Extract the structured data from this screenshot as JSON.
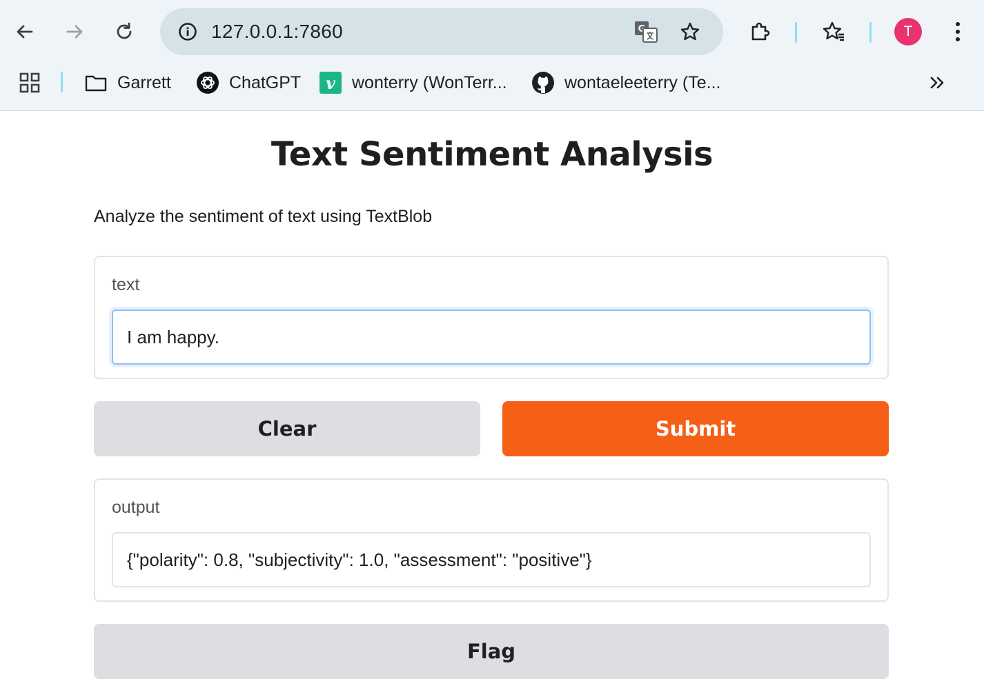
{
  "browser": {
    "url": "127.0.0.1:7860",
    "profile_initial": "T",
    "bookmarks": [
      {
        "label": "Garrett",
        "icon": "folder-icon"
      },
      {
        "label": "ChatGPT",
        "icon": "chatgpt-icon"
      },
      {
        "label": "wonterry (WonTerr...",
        "icon": "vimeo-icon"
      },
      {
        "label": "wontaeleeterry (Te...",
        "icon": "github-icon"
      }
    ]
  },
  "app": {
    "title": "Text Sentiment Analysis",
    "description": "Analyze the sentiment of text using TextBlob",
    "input": {
      "label": "text",
      "value": "I am happy."
    },
    "buttons": {
      "clear": "Clear",
      "submit": "Submit",
      "flag": "Flag"
    },
    "output": {
      "label": "output",
      "value": "{\"polarity\": 0.8, \"subjectivity\": 1.0, \"assessment\": \"positive\"}"
    }
  },
  "colors": {
    "primary_button": "#f55f16",
    "secondary_button": "#dedee2",
    "avatar": "#e8336f",
    "input_focus_border": "#8fc0f2"
  }
}
